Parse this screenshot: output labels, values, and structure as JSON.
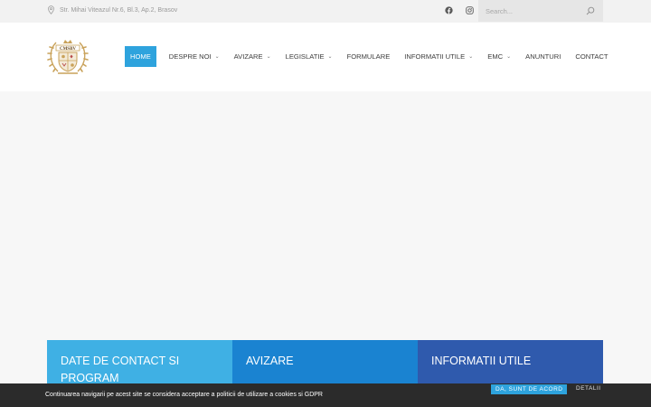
{
  "topbar": {
    "address": "Str. Mihai Viteazul Nr.6, Bl.3, Ap.2, Brasov",
    "address_icon": "map-pin-icon",
    "social": [
      {
        "name": "facebook-icon"
      },
      {
        "name": "instagram-icon"
      }
    ],
    "search": {
      "placeholder": "Search...",
      "value": ""
    }
  },
  "header": {
    "logo_text": "CMSBV",
    "nav": [
      {
        "label": "HOME",
        "active": true,
        "dropdown": false
      },
      {
        "label": "DESPRE NOI",
        "active": false,
        "dropdown": true
      },
      {
        "label": "AVIZARE",
        "active": false,
        "dropdown": true
      },
      {
        "label": "LEGISLATIE",
        "active": false,
        "dropdown": true
      },
      {
        "label": "FORMULARE",
        "active": false,
        "dropdown": false
      },
      {
        "label": "INFORMATII UTILE",
        "active": false,
        "dropdown": true
      },
      {
        "label": "EMC",
        "active": false,
        "dropdown": true
      },
      {
        "label": "ANUNTURI",
        "active": false,
        "dropdown": false
      },
      {
        "label": "CONTACT",
        "active": false,
        "dropdown": false
      }
    ]
  },
  "cards": [
    {
      "title": "DATE DE CONTACT SI PROGRAM"
    },
    {
      "title": "AVIZARE"
    },
    {
      "title": "INFORMATII UTILE"
    }
  ],
  "cookie": {
    "text": "Continuarea navigarii pe acest site se considera acceptare a politicii de utilizare a cookies si GDPR",
    "accept_label": "DA, SUNT DE ACORD",
    "details_label": "DETALII"
  },
  "colors": {
    "accent": "#2ea3dd",
    "card1": "#3fb0e4",
    "card2": "#1a83d1",
    "card3": "#2f5aad",
    "cookie_bg": "#2b2b2b",
    "logo_gold": "#c9a25a"
  }
}
